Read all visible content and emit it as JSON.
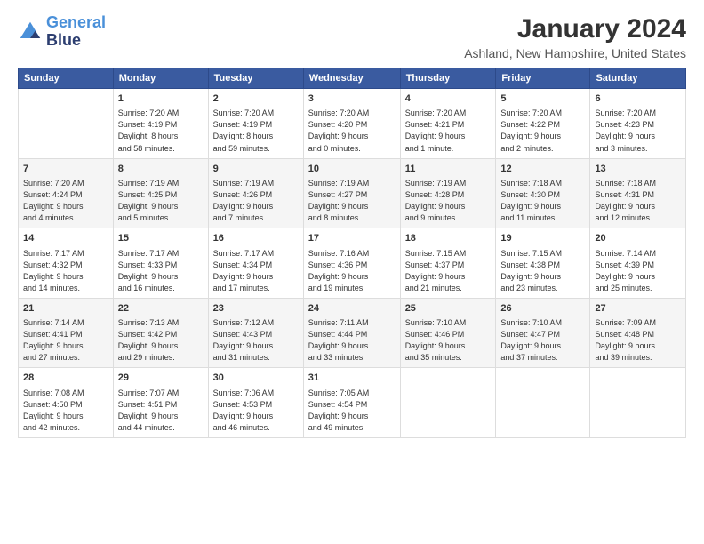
{
  "logo": {
    "line1": "General",
    "line2": "Blue"
  },
  "title": "January 2024",
  "location": "Ashland, New Hampshire, United States",
  "headers": [
    "Sunday",
    "Monday",
    "Tuesday",
    "Wednesday",
    "Thursday",
    "Friday",
    "Saturday"
  ],
  "weeks": [
    [
      {
        "day": "",
        "info": ""
      },
      {
        "day": "1",
        "info": "Sunrise: 7:20 AM\nSunset: 4:19 PM\nDaylight: 8 hours\nand 58 minutes."
      },
      {
        "day": "2",
        "info": "Sunrise: 7:20 AM\nSunset: 4:19 PM\nDaylight: 8 hours\nand 59 minutes."
      },
      {
        "day": "3",
        "info": "Sunrise: 7:20 AM\nSunset: 4:20 PM\nDaylight: 9 hours\nand 0 minutes."
      },
      {
        "day": "4",
        "info": "Sunrise: 7:20 AM\nSunset: 4:21 PM\nDaylight: 9 hours\nand 1 minute."
      },
      {
        "day": "5",
        "info": "Sunrise: 7:20 AM\nSunset: 4:22 PM\nDaylight: 9 hours\nand 2 minutes."
      },
      {
        "day": "6",
        "info": "Sunrise: 7:20 AM\nSunset: 4:23 PM\nDaylight: 9 hours\nand 3 minutes."
      }
    ],
    [
      {
        "day": "7",
        "info": "Sunrise: 7:20 AM\nSunset: 4:24 PM\nDaylight: 9 hours\nand 4 minutes."
      },
      {
        "day": "8",
        "info": "Sunrise: 7:19 AM\nSunset: 4:25 PM\nDaylight: 9 hours\nand 5 minutes."
      },
      {
        "day": "9",
        "info": "Sunrise: 7:19 AM\nSunset: 4:26 PM\nDaylight: 9 hours\nand 7 minutes."
      },
      {
        "day": "10",
        "info": "Sunrise: 7:19 AM\nSunset: 4:27 PM\nDaylight: 9 hours\nand 8 minutes."
      },
      {
        "day": "11",
        "info": "Sunrise: 7:19 AM\nSunset: 4:28 PM\nDaylight: 9 hours\nand 9 minutes."
      },
      {
        "day": "12",
        "info": "Sunrise: 7:18 AM\nSunset: 4:30 PM\nDaylight: 9 hours\nand 11 minutes."
      },
      {
        "day": "13",
        "info": "Sunrise: 7:18 AM\nSunset: 4:31 PM\nDaylight: 9 hours\nand 12 minutes."
      }
    ],
    [
      {
        "day": "14",
        "info": "Sunrise: 7:17 AM\nSunset: 4:32 PM\nDaylight: 9 hours\nand 14 minutes."
      },
      {
        "day": "15",
        "info": "Sunrise: 7:17 AM\nSunset: 4:33 PM\nDaylight: 9 hours\nand 16 minutes."
      },
      {
        "day": "16",
        "info": "Sunrise: 7:17 AM\nSunset: 4:34 PM\nDaylight: 9 hours\nand 17 minutes."
      },
      {
        "day": "17",
        "info": "Sunrise: 7:16 AM\nSunset: 4:36 PM\nDaylight: 9 hours\nand 19 minutes."
      },
      {
        "day": "18",
        "info": "Sunrise: 7:15 AM\nSunset: 4:37 PM\nDaylight: 9 hours\nand 21 minutes."
      },
      {
        "day": "19",
        "info": "Sunrise: 7:15 AM\nSunset: 4:38 PM\nDaylight: 9 hours\nand 23 minutes."
      },
      {
        "day": "20",
        "info": "Sunrise: 7:14 AM\nSunset: 4:39 PM\nDaylight: 9 hours\nand 25 minutes."
      }
    ],
    [
      {
        "day": "21",
        "info": "Sunrise: 7:14 AM\nSunset: 4:41 PM\nDaylight: 9 hours\nand 27 minutes."
      },
      {
        "day": "22",
        "info": "Sunrise: 7:13 AM\nSunset: 4:42 PM\nDaylight: 9 hours\nand 29 minutes."
      },
      {
        "day": "23",
        "info": "Sunrise: 7:12 AM\nSunset: 4:43 PM\nDaylight: 9 hours\nand 31 minutes."
      },
      {
        "day": "24",
        "info": "Sunrise: 7:11 AM\nSunset: 4:44 PM\nDaylight: 9 hours\nand 33 minutes."
      },
      {
        "day": "25",
        "info": "Sunrise: 7:10 AM\nSunset: 4:46 PM\nDaylight: 9 hours\nand 35 minutes."
      },
      {
        "day": "26",
        "info": "Sunrise: 7:10 AM\nSunset: 4:47 PM\nDaylight: 9 hours\nand 37 minutes."
      },
      {
        "day": "27",
        "info": "Sunrise: 7:09 AM\nSunset: 4:48 PM\nDaylight: 9 hours\nand 39 minutes."
      }
    ],
    [
      {
        "day": "28",
        "info": "Sunrise: 7:08 AM\nSunset: 4:50 PM\nDaylight: 9 hours\nand 42 minutes."
      },
      {
        "day": "29",
        "info": "Sunrise: 7:07 AM\nSunset: 4:51 PM\nDaylight: 9 hours\nand 44 minutes."
      },
      {
        "day": "30",
        "info": "Sunrise: 7:06 AM\nSunset: 4:53 PM\nDaylight: 9 hours\nand 46 minutes."
      },
      {
        "day": "31",
        "info": "Sunrise: 7:05 AM\nSunset: 4:54 PM\nDaylight: 9 hours\nand 49 minutes."
      },
      {
        "day": "",
        "info": ""
      },
      {
        "day": "",
        "info": ""
      },
      {
        "day": "",
        "info": ""
      }
    ]
  ]
}
